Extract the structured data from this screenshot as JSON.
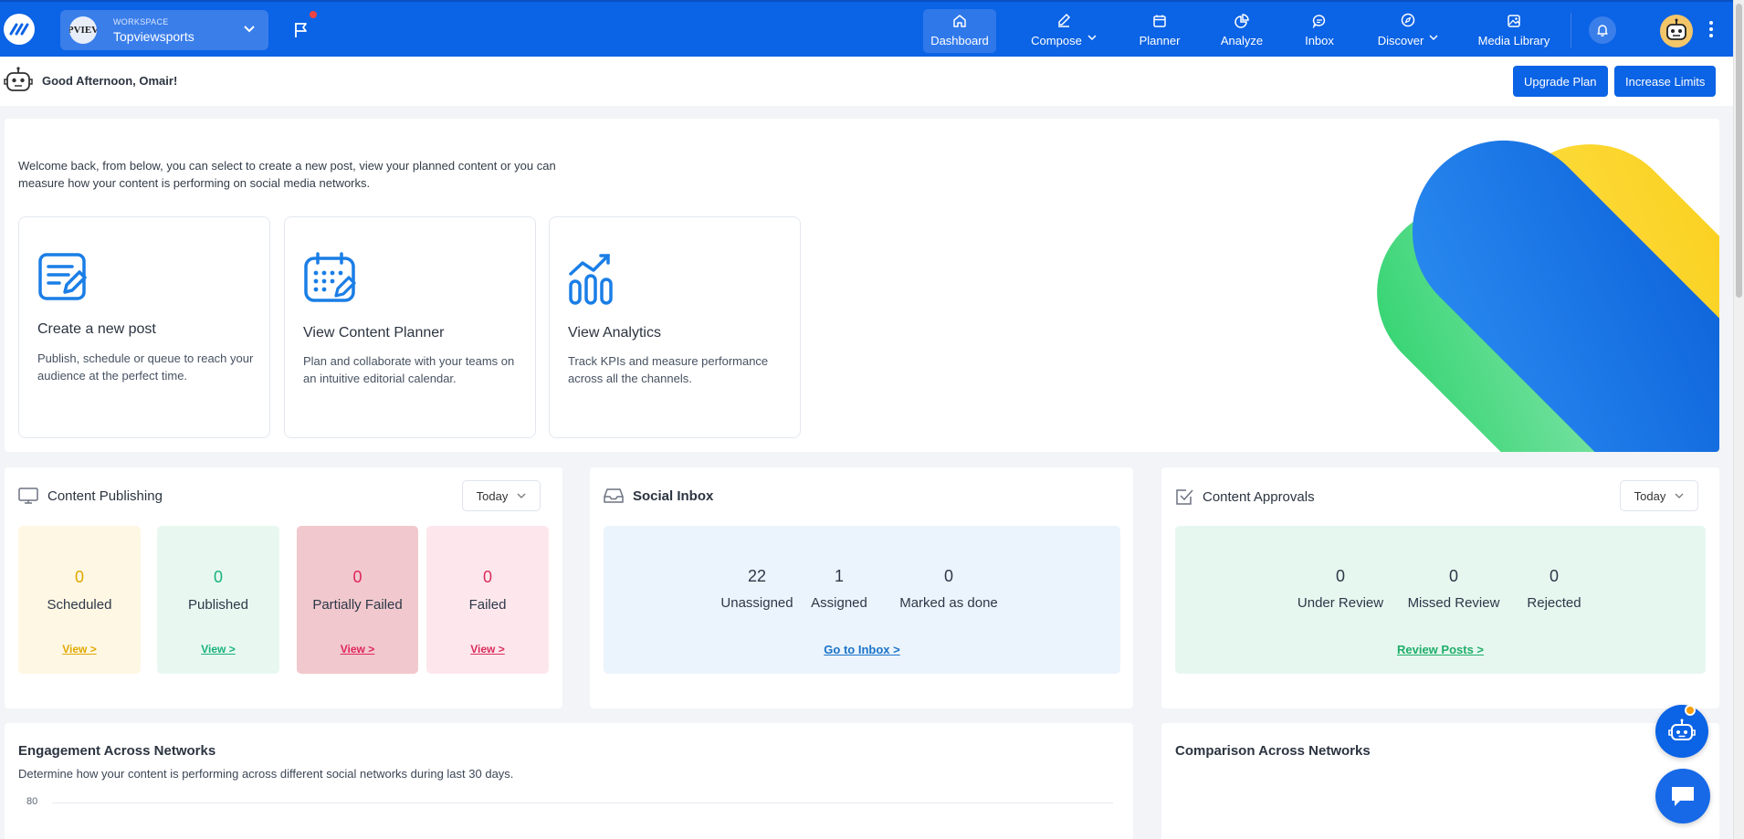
{
  "topbar": {
    "workspace_caption": "WORKSPACE",
    "workspace_name": "Topviewsports",
    "workspace_avatar_text": "PVIEV",
    "nav": [
      {
        "label": "Dashboard",
        "icon": "home-icon",
        "active": true
      },
      {
        "label": "Compose",
        "icon": "pencil-icon",
        "dropdown": true
      },
      {
        "label": "Planner",
        "icon": "calendar-icon"
      },
      {
        "label": "Analyze",
        "icon": "pie-chart-icon"
      },
      {
        "label": "Inbox",
        "icon": "chat-bubble-icon"
      },
      {
        "label": "Discover",
        "icon": "compass-icon",
        "dropdown": true
      },
      {
        "label": "Media Library",
        "icon": "image-icon"
      }
    ]
  },
  "greeting": {
    "text": "Good Afternoon, Omair!",
    "upgrade_label": "Upgrade Plan",
    "limits_label": "Increase Limits"
  },
  "welcome": {
    "text": "Welcome back, from below, you can select to create a new post, view your planned content or you can measure how your content is performing on social media networks.",
    "cards": [
      {
        "title": "Create a new post",
        "desc": "Publish, schedule or queue to reach your audience at the perfect time.",
        "icon": "compose-post-icon"
      },
      {
        "title": "View Content Planner",
        "desc": "Plan and collaborate with your teams on an intuitive editorial calendar.",
        "icon": "calendar-planner-icon"
      },
      {
        "title": "View Analytics",
        "desc": "Track KPIs and measure performance across all the channels.",
        "icon": "analytics-chart-icon"
      }
    ]
  },
  "publishing": {
    "title": "Content Publishing",
    "filter": "Today",
    "stats": [
      {
        "value": "0",
        "label": "Scheduled",
        "link": "View >",
        "color": "#e0a800",
        "bg": "#fef7e3"
      },
      {
        "value": "0",
        "label": "Published",
        "link": "View >",
        "color": "#16b27a",
        "bg": "#e8f8f0"
      },
      {
        "value": "0",
        "label": "Partially Failed",
        "link": "View >",
        "color": "#e0245e",
        "bg": "#f1c8cd"
      },
      {
        "value": "0",
        "label": "Failed",
        "link": "View >",
        "color": "#d92c5c",
        "bg": "#fde7ec"
      }
    ]
  },
  "inbox": {
    "title": "Social Inbox",
    "stats": [
      {
        "value": "22",
        "label": "Unassigned"
      },
      {
        "value": "1",
        "label": "Assigned"
      },
      {
        "value": "0",
        "label": "Marked as done"
      }
    ],
    "link": "Go to Inbox >"
  },
  "approvals": {
    "title": "Content Approvals",
    "filter": "Today",
    "stats": [
      {
        "value": "0",
        "label": "Under Review"
      },
      {
        "value": "0",
        "label": "Missed Review"
      },
      {
        "value": "0",
        "label": "Rejected"
      }
    ],
    "link": "Review Posts >"
  },
  "engagement": {
    "title": "Engagement Across Networks",
    "subtitle": "Determine how your content is performing across different social networks during last 30 days.",
    "y_tick": "80"
  },
  "comparison": {
    "title": "Comparison Across Networks"
  },
  "colors": {
    "brand": "#0b63e5",
    "inbox_bg": "#ebf4fc",
    "approvals_bg": "#e6f7ef",
    "inbox_link": "#1a73c9",
    "approvals_link": "#1fae6a"
  }
}
